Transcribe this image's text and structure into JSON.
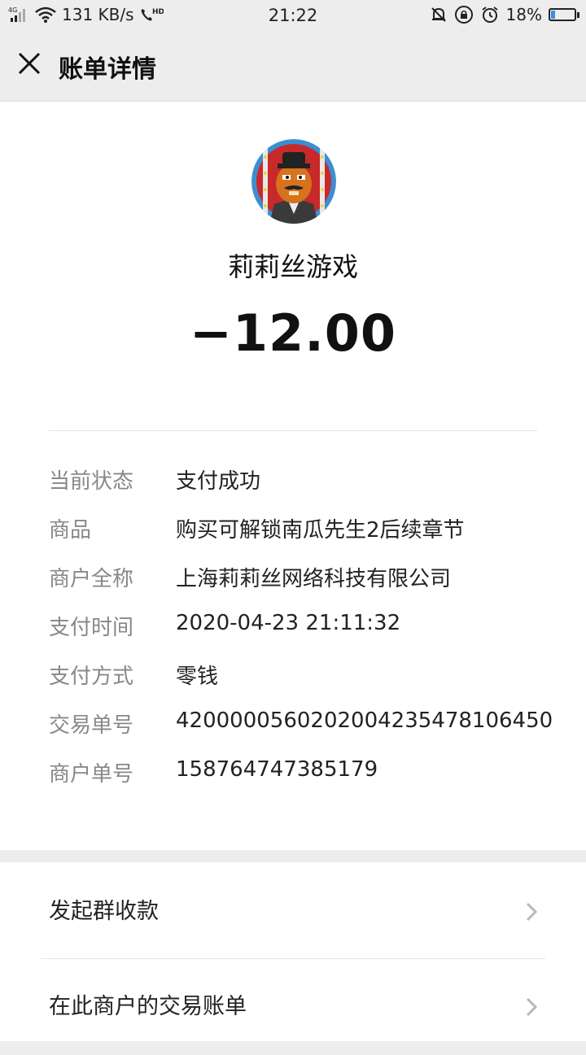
{
  "status_bar": {
    "network": "4G",
    "speed": "131 KB/s",
    "hd": "HD",
    "time": "21:22",
    "battery": "18%",
    "battery_level": 0.18
  },
  "header": {
    "title": "账单详情"
  },
  "merchant": {
    "name": "莉莉丝游戏",
    "amount": "−12.00"
  },
  "details": [
    {
      "label": "当前状态",
      "value": "支付成功"
    },
    {
      "label": "商品",
      "value": "购买可解锁南瓜先生2后续章节"
    },
    {
      "label": "商户全称",
      "value": "上海莉莉丝网络科技有限公司"
    },
    {
      "label": "支付时间",
      "value": "2020-04-23 21:11:32"
    },
    {
      "label": "支付方式",
      "value": "零钱"
    },
    {
      "label": "交易单号",
      "value": "4200000560202004235478106450"
    },
    {
      "label": "商户单号",
      "value": "158764747385179"
    }
  ],
  "menu": {
    "group_collect": "发起群收款",
    "merchant_bills": "在此商户的交易账单"
  },
  "colors": {
    "background": "#ededed",
    "card": "#ffffff",
    "label_gray": "#888888",
    "battery_blue": "#3a8fe8"
  }
}
